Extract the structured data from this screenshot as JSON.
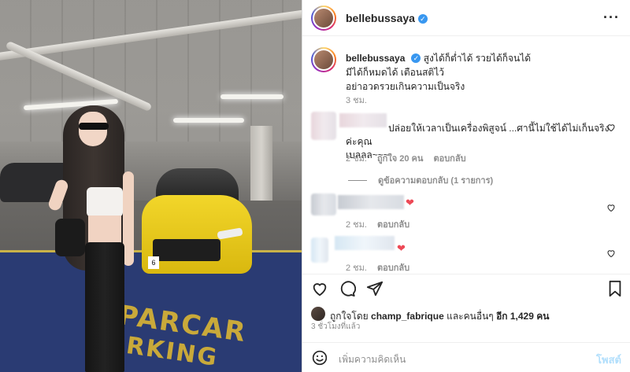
{
  "post": {
    "username": "bellebussaya",
    "verified_icon": "verified-badge-icon",
    "caption_lines": [
      "สูงได้ก็ต่ำได้ รวยได้ก็จนได้",
      "มีได้ก็หมดได้ เตือนสติไว้",
      "อย่าอวดรวยเกินความเป็นจริง"
    ],
    "caption_time": "3 ชม."
  },
  "photo": {
    "floor_text_1": "PARCAR",
    "floor_text_2": "RKING",
    "plate_text": "6"
  },
  "comments": [
    {
      "text_line1": "ปล่อยให้เวลาเป็นเครื่องพิสูจน์ ...ศานี้ไม่ใช้ได้ไม่เก็นจริงค่ะคุณ",
      "text_line2": "เบลลล~~~",
      "time": "2 ชม.",
      "likes": "ถูกใจ 20 คน",
      "reply": "ตอบกลับ"
    },
    {
      "text": "❤",
      "time": "2 ชม.",
      "reply": "ตอบกลับ"
    },
    {
      "text": "❤",
      "time": "2 ชม.",
      "reply": "ตอบกลับ"
    }
  ],
  "view_replies": "ดูข้อความตอบกลับ (1 รายการ)",
  "liked_by": {
    "prefix": "ถูกใจโดย",
    "user": "champ_fabrique",
    "mid": "และคนอื่นๆ",
    "count_text": "อีก 1,429 คน"
  },
  "post_age": "3 ชั่วโมงที่แล้ว",
  "add_comment": {
    "placeholder": "เพิ่มความคิดเห็น",
    "post_label": "โพสต์"
  },
  "colors": {
    "verified": "#3897f0",
    "heart_red": "#ed4956",
    "muted": "#8e8e8e",
    "post_disabled": "#b2dffc"
  }
}
